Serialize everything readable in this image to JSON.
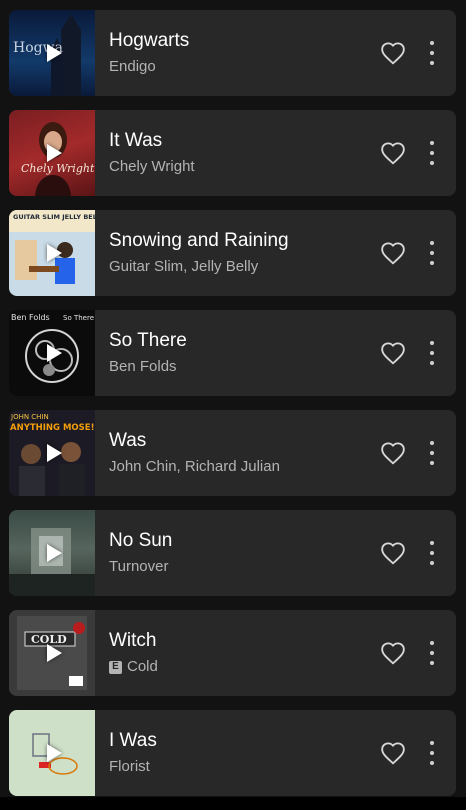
{
  "tracks": [
    {
      "title": "Hogwarts",
      "artist": "Endigo",
      "explicit": false,
      "art": "hogwarts"
    },
    {
      "title": "It Was",
      "artist": "Chely Wright",
      "explicit": false,
      "art": "chely"
    },
    {
      "title": "Snowing and Raining",
      "artist": "Guitar Slim, Jelly Belly",
      "explicit": false,
      "art": "guitar"
    },
    {
      "title": "So There",
      "artist": "Ben Folds",
      "explicit": false,
      "art": "bf"
    },
    {
      "title": "Was",
      "artist": "John Chin, Richard Julian",
      "explicit": false,
      "art": "jc"
    },
    {
      "title": "No Sun",
      "artist": "Turnover",
      "explicit": false,
      "art": "turnover"
    },
    {
      "title": "Witch",
      "artist": "Cold",
      "explicit": true,
      "explicit_label": "E",
      "art": "cold"
    },
    {
      "title": "I Was",
      "artist": "Florist",
      "explicit": false,
      "art": "florist"
    }
  ],
  "album_art_text": {
    "hogwarts": "Hogwa",
    "chely": "Chely Wright",
    "guitar": "GUITAR SLIM JELLY BELLY",
    "bf_left": "Ben Folds",
    "bf_right": "So There",
    "jc_top": "JOHN CHIN",
    "jc_mid": "ANYTHING MOSE!",
    "cold": "COLD"
  },
  "colors": {
    "background": "#121212",
    "card": "#282828",
    "secondary_text": "#b3b3b3"
  }
}
